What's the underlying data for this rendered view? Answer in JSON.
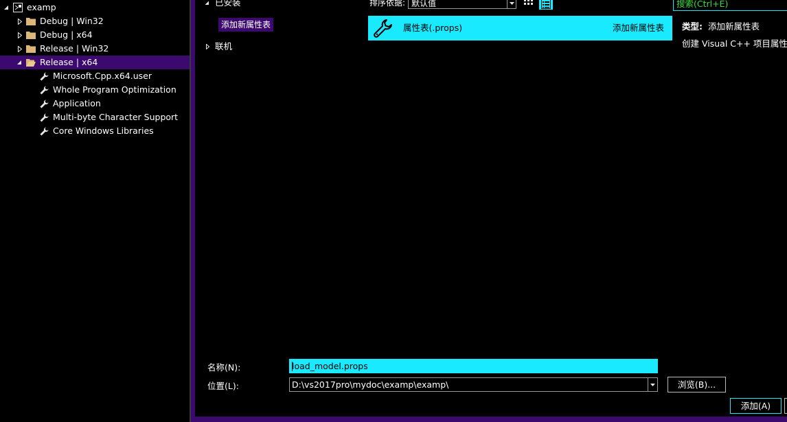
{
  "solution_tree": {
    "project": "examp",
    "configs": [
      {
        "label": "Debug | Win32",
        "expanded": false
      },
      {
        "label": "Debug | x64",
        "expanded": false
      },
      {
        "label": "Release | Win32",
        "expanded": false
      },
      {
        "label": "Release | x64",
        "expanded": true,
        "selected": true
      }
    ],
    "property_sheets": [
      "Microsoft.Cpp.x64.user",
      "Whole Program Optimization",
      "Application",
      "Multi-byte Character Support",
      "Core Windows Libraries"
    ]
  },
  "categories": {
    "installed": "已安装",
    "add_new_sheet": "添加新属性表",
    "online": "联机"
  },
  "sort": {
    "label": "排序依据:",
    "value": "默认值"
  },
  "search": {
    "placeholder": "搜索(Ctrl+E)"
  },
  "template": {
    "name": "属性表(.props)",
    "type": "添加新属性表",
    "icon": "wrench-icon"
  },
  "description": {
    "type_label": "类型:",
    "type_value": "添加新属性表",
    "text": "创建 Visual C++ 项目属性表"
  },
  "form": {
    "name_label": "名称(N):",
    "name_value": "load_model.props",
    "location_label": "位置(L):",
    "location_value": "D:\\vs2017pro\\mydoc\\examp\\examp\\",
    "browse_label": "浏览(B)...",
    "add_label": "添加(A)"
  },
  "colors": {
    "accent": "#1aeaff",
    "selection": "#3c0a6e",
    "search_text": "#3ddc3d"
  }
}
